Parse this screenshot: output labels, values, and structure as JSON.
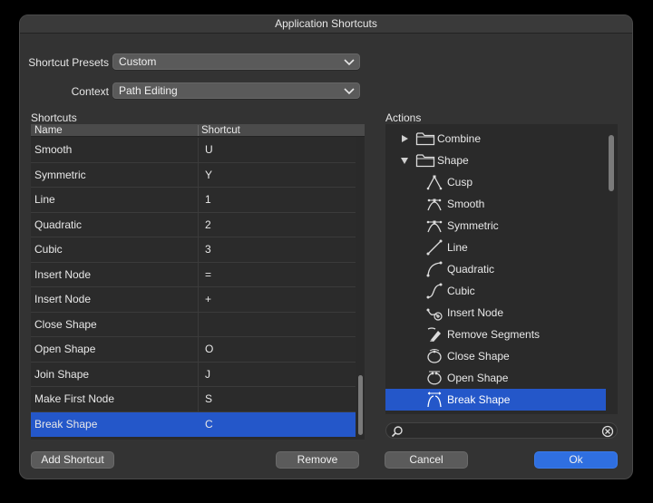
{
  "window": {
    "title": "Application Shortcuts"
  },
  "presets": {
    "label": "Shortcut Presets",
    "value": "Custom"
  },
  "context": {
    "label": "Context",
    "value": "Path Editing"
  },
  "shortcuts": {
    "title": "Shortcuts",
    "columns": [
      "Name",
      "Shortcut"
    ],
    "rows": [
      {
        "name": "Smooth",
        "key": "U"
      },
      {
        "name": "Symmetric",
        "key": "Y"
      },
      {
        "name": "Line",
        "key": "1"
      },
      {
        "name": "Quadratic",
        "key": "2"
      },
      {
        "name": "Cubic",
        "key": "3"
      },
      {
        "name": "Insert Node",
        "key": "="
      },
      {
        "name": "Insert Node",
        "key": "+"
      },
      {
        "name": "Close Shape",
        "key": ""
      },
      {
        "name": "Open Shape",
        "key": "O"
      },
      {
        "name": "Join Shape",
        "key": "J"
      },
      {
        "name": "Make First Node",
        "key": "S"
      },
      {
        "name": "Break Shape",
        "key": "C"
      }
    ],
    "selected_index": 11
  },
  "actions": {
    "title": "Actions",
    "items": [
      {
        "label": "Combine",
        "icon": "folder-icon",
        "expanded": false
      },
      {
        "label": "Shape",
        "icon": "folder-icon",
        "expanded": true
      },
      {
        "label": "Cusp",
        "icon": "cusp-node-icon"
      },
      {
        "label": "Smooth",
        "icon": "smooth-node-icon"
      },
      {
        "label": "Symmetric",
        "icon": "symmetric-node-icon"
      },
      {
        "label": "Line",
        "icon": "line-segment-icon"
      },
      {
        "label": "Quadratic",
        "icon": "quadratic-segment-icon"
      },
      {
        "label": "Cubic",
        "icon": "cubic-segment-icon"
      },
      {
        "label": "Insert Node",
        "icon": "insert-node-icon"
      },
      {
        "label": "Remove Segments",
        "icon": "remove-segments-icon"
      },
      {
        "label": "Close Shape",
        "icon": "close-shape-icon"
      },
      {
        "label": "Open Shape",
        "icon": "open-shape-icon"
      },
      {
        "label": "Break Shape",
        "icon": "break-shape-icon"
      }
    ],
    "selected_label": "Break Shape",
    "search_placeholder": ""
  },
  "buttons": {
    "add_shortcut": "Add Shortcut",
    "remove": "Remove",
    "cancel": "Cancel",
    "ok": "Ok"
  },
  "colors": {
    "selection": "#2457c9",
    "primary_button": "#2f6fe0",
    "dialog_bg": "#333333"
  }
}
